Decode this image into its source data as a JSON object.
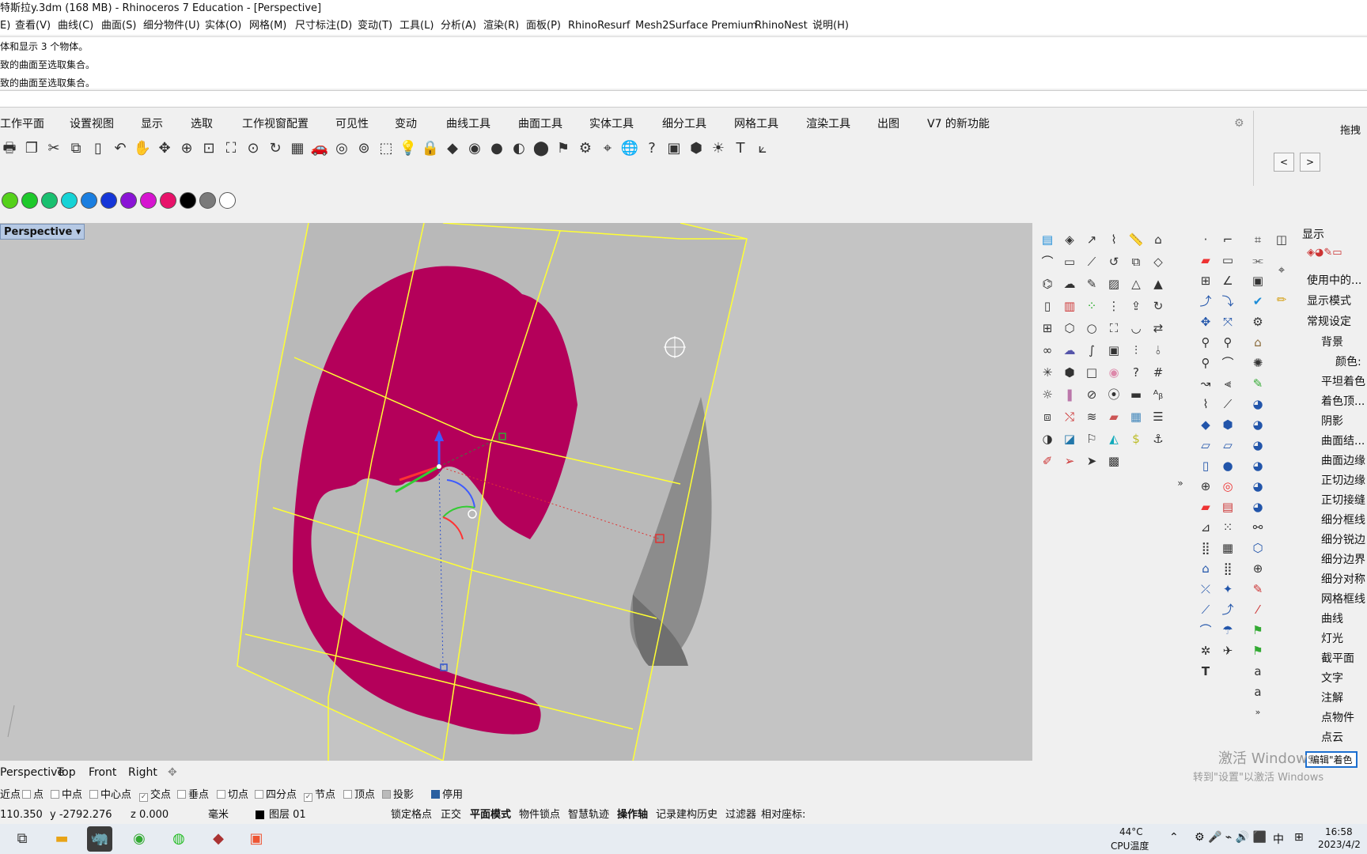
{
  "window": {
    "title": "特斯拉y.3dm (168 MB) - Rhinoceros 7 Education - [Perspective]"
  },
  "menu": [
    "E)",
    "查看(V)",
    "曲线(C)",
    "曲面(S)",
    "细分物件(U)",
    "实体(O)",
    "网格(M)",
    "尺寸标注(D)",
    "变动(T)",
    "工具(L)",
    "分析(A)",
    "渲染(R)",
    "面板(P)",
    "RhinoResurf",
    "Mesh2Surface Premium",
    "RhinoNest",
    "说明(H)"
  ],
  "command_history": [
    "体和显示 3 个物体。",
    "致的曲面至选取集合。",
    "致的曲面至选取集合。"
  ],
  "toolbar_tabs": [
    "工作平面",
    "设置视图",
    "显示",
    "选取",
    "工作视窗配置",
    "可见性",
    "变动",
    "曲线工具",
    "曲面工具",
    "实体工具",
    "细分工具",
    "网格工具",
    "渲染工具",
    "出图",
    "V7 的新功能"
  ],
  "right_strip": {
    "label": "拖拽",
    "prev": "<",
    "next": ">"
  },
  "color_swatches": [
    "#55d11a",
    "#1ec92b",
    "#19c070",
    "#16d3d6",
    "#1a7ee0",
    "#1536d8",
    "#8a14d6",
    "#d615d0",
    "#e8126a",
    "#000000",
    "#7a7a7a",
    "#ffffff"
  ],
  "viewport": {
    "label": "Perspective",
    "background": "#c4c4c4",
    "shape_color": "#b4005a",
    "surface_color": "#ffff33"
  },
  "viewport_tabs": [
    "Perspective",
    "Top",
    "Front",
    "Right"
  ],
  "osnaps": [
    {
      "label": "近点",
      "checked": false
    },
    {
      "label": "点",
      "checked": false
    },
    {
      "label": "中点",
      "checked": false
    },
    {
      "label": "中心点",
      "checked": false
    },
    {
      "label": "交点",
      "checked": true
    },
    {
      "label": "垂点",
      "checked": false
    },
    {
      "label": "切点",
      "checked": false
    },
    {
      "label": "四分点",
      "checked": false
    },
    {
      "label": "节点",
      "checked": true
    },
    {
      "label": "顶点",
      "checked": false
    },
    {
      "label": "投影",
      "checked": false
    },
    {
      "label": "停用",
      "checked": false
    }
  ],
  "status": {
    "x": "110.350",
    "y": "y -2792.276",
    "z": "z 0.000",
    "unit": "毫米",
    "layer": "图层 01",
    "toggles": [
      "锁定格点",
      "正交",
      "平面模式",
      "物件锁点",
      "智慧轨迹",
      "操作轴",
      "记录建构历史",
      "过滤器",
      "相对座标:"
    ]
  },
  "display_panel": {
    "header": "显示",
    "items": [
      "使用中的...",
      "显示模式",
      "常规设定",
      "背景",
      "颜色:",
      "平坦着色",
      "着色顶...",
      "阴影",
      "曲面结...",
      "曲面边缘",
      "正切边缘",
      "正切接缝",
      "细分框线",
      "细分锐边",
      "细分边界",
      "细分对称",
      "网格框线",
      "曲线",
      "灯光",
      "截平面",
      "文字",
      "注解",
      "点物件",
      "点云"
    ],
    "bottom_button": "编辑\"着色"
  },
  "watermark": {
    "line1": "激活 Windows",
    "line2": "转到\"设置\"以激活 Windows"
  },
  "taskbar": {
    "temp": "44°C",
    "cpu_label": "CPU温度",
    "ime": "中",
    "time": "16:58",
    "date": "2023/4/2"
  }
}
